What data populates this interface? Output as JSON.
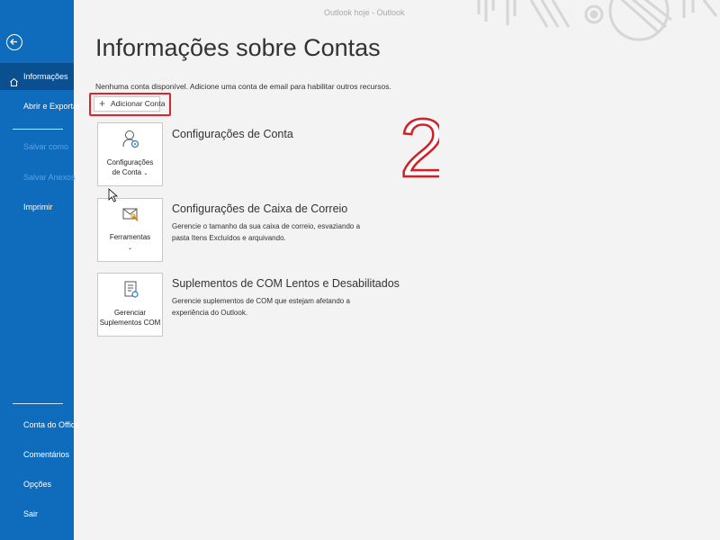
{
  "window": {
    "title": "Outlook hoje  -  Outlook"
  },
  "sidebar": {
    "items": [
      {
        "label": "Informações"
      },
      {
        "label": "Abrir e Exportar"
      },
      {
        "label": "Salvar como"
      },
      {
        "label": "Salvar Anexos"
      },
      {
        "label": "Imprimir"
      }
    ],
    "bottom_items": [
      {
        "label": "Conta do Office"
      },
      {
        "label": "Comentários"
      },
      {
        "label": "Opções"
      },
      {
        "label": "Sair"
      }
    ]
  },
  "main": {
    "title": "Informações sobre Contas",
    "subtitle": "Nenhuma conta disponível. Adicione uma conta de email para habilitar outros recursos.",
    "add_account_label": "Adicionar Conta",
    "annotation_number": "2",
    "sections": [
      {
        "tile_line1": "Configurações",
        "tile_line2": "de Conta",
        "title": "Configurações de Conta",
        "description": ""
      },
      {
        "tile_line1": "Ferramentas",
        "tile_line2": "",
        "title": "Configurações de Caixa de Correio",
        "description": "Gerencie o tamanho da sua caixa de correio, esvaziando a pasta Itens Excluídos e arquivando."
      },
      {
        "tile_line1": "Gerenciar",
        "tile_line2": "Suplementos COM",
        "title": "Suplementos de COM Lentos e Desabilitados",
        "description": "Gerencie suplementos de COM que estejam afetando a experiência do Outlook."
      }
    ]
  },
  "colors": {
    "sidebar": "#0f6cbd",
    "sidebar_active": "#0a4f8f",
    "highlight": "#e0222a"
  }
}
